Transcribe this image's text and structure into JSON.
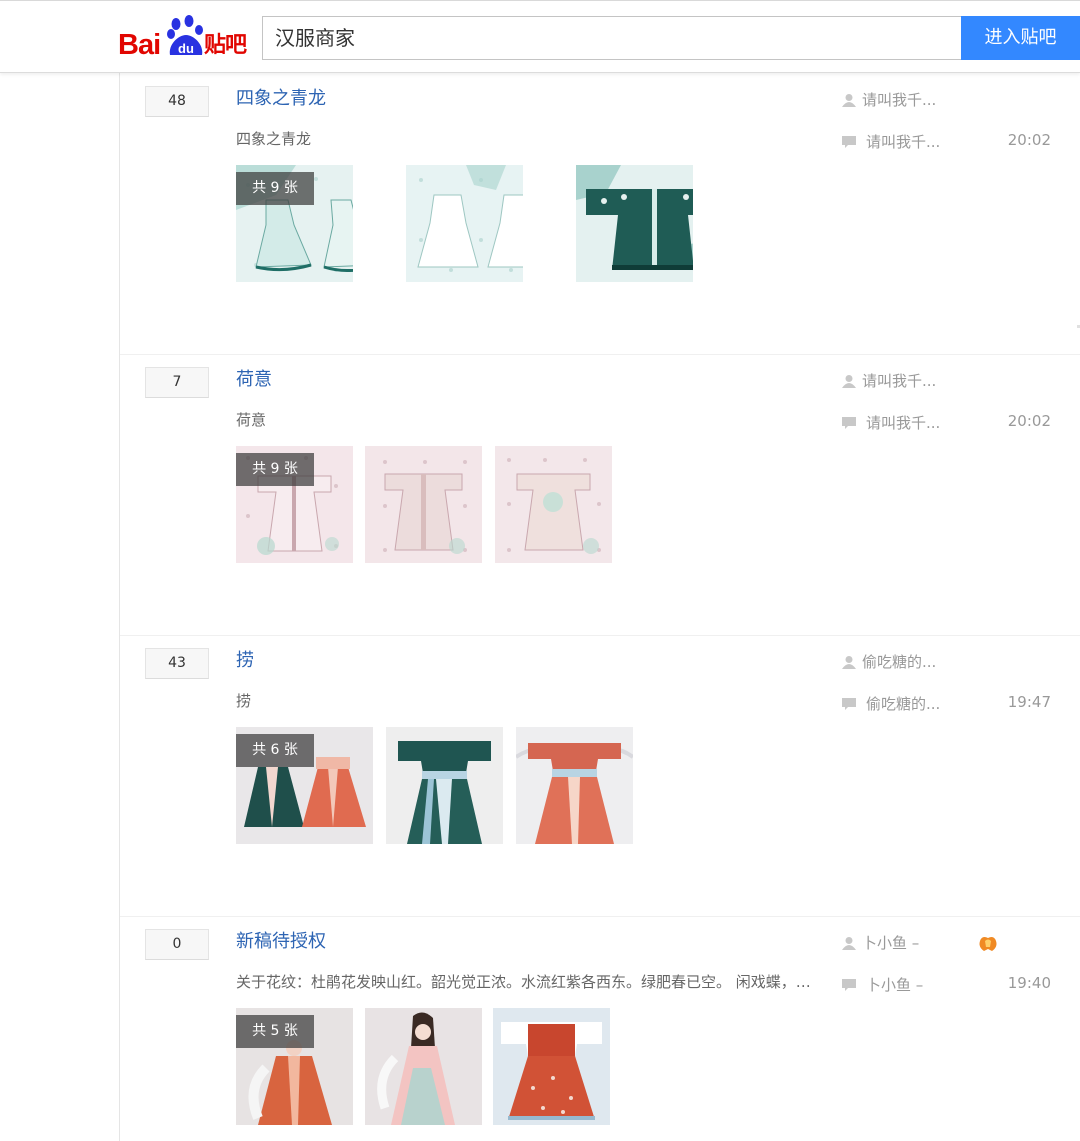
{
  "header": {
    "logo": {
      "text_bai": "Bai",
      "text_du": "du",
      "text_tieba": "贴吧"
    },
    "search_value": "汉服商家",
    "enter_button": "进入贴吧"
  },
  "colors": {
    "link": "#2d64b3",
    "button": "#3388ff",
    "logo_red": "#e10601",
    "logo_blue": "#2932e1"
  },
  "threads": [
    {
      "replies": "48",
      "title": "四象之青龙",
      "abstract": "四象之青龙",
      "photo_count": "共 9 张",
      "author": "请叫我千...",
      "last_replier": "请叫我千...",
      "time": "20:02",
      "images": [
        "celadon-dress-front",
        "pale-dress-back",
        "dark-green-robe"
      ]
    },
    {
      "replies": "7",
      "title": "荷意",
      "abstract": "荷意",
      "photo_count": "共 9 张",
      "author": "请叫我千...",
      "last_replier": "请叫我千...",
      "time": "20:02",
      "images": [
        "pink-dress-pattern",
        "pink-dress-pattern",
        "pink-dress-pattern"
      ]
    },
    {
      "replies": "43",
      "title": "捞",
      "abstract": "捞",
      "photo_count": "共 6 张",
      "author": "偷吃糖的...",
      "last_replier": "偷吃糖的...",
      "time": "19:47",
      "images": [
        "green-and-red-dresses",
        "teal-robe",
        "coral-robe"
      ]
    },
    {
      "replies": "0",
      "title": "新稿待授权",
      "abstract": "关于花纹：杜鹃花发映山红。韶光觉正浓。水流红紫各西东。绿肥春已空。 闲戏蝶，…",
      "photo_count": "共 5 张",
      "author": "卜小鱼 –",
      "last_replier": "卜小鱼 –",
      "time": "19:40",
      "has_badge": true,
      "images": [
        "orange-dress-figure",
        "girl-in-pink-hanfu",
        "coral-robe-on-blue"
      ]
    }
  ]
}
